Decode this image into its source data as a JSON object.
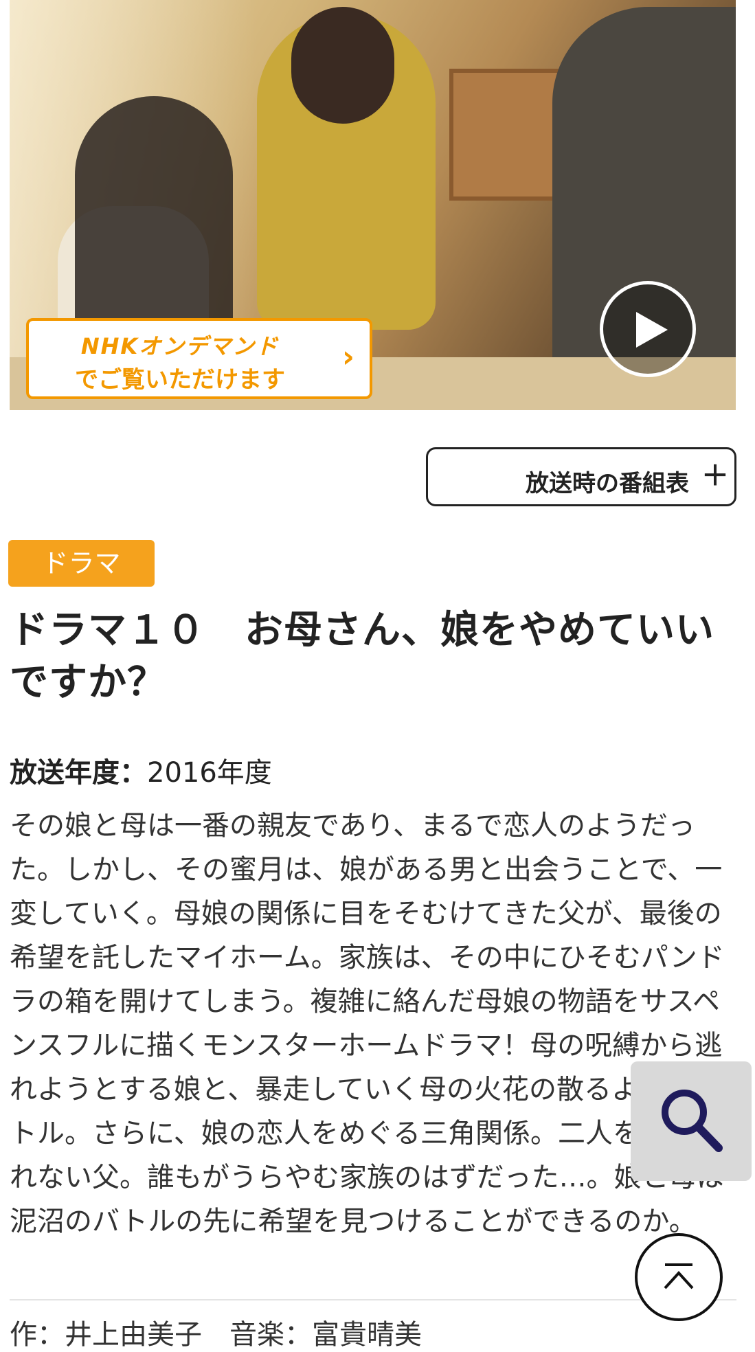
{
  "hero": {
    "ondemand_line1": "NHKオンデマンド",
    "ondemand_line2": "でご覧いただけます",
    "ondemand_arrow": "›",
    "play_icon": "play-icon"
  },
  "schedule_button": {
    "label": "放送時の番組表",
    "icon": "plus-icon",
    "icon_glyph": "＋"
  },
  "genre_badge": "ドラマ",
  "program_title": "ドラマ１０　お母さん、娘をやめていいですか？",
  "broadcast_year": {
    "label": "放送年度：",
    "value": "2016年度"
  },
  "description": "その娘と母は一番の親友であり、まるで恋人のようだった。しかし、その蜜月は、娘がある男と出会うことで、一変していく。母娘の関係に目をそむけてきた父が、最後の希望を託したマイホーム。家族は、その中にひそむパンドラの箱を開けてしまう。複雑に絡んだ母娘の物語をサスペンスフルに描くモンスターホームドラマ！母の呪縛から逃れようとする娘と、暴走していく母の火花の散るようなバトル。さらに、娘の恋人をめぐる三角関係。二人を止められない父。誰もがうらやむ家族のはずだった…。娘と母は泥沼のバトルの先に希望を見つけることができるのか。",
  "credits": "作：井上由美子　音楽：富貴晴美",
  "floating": {
    "search_icon": "search-icon",
    "back_to_top_icon": "back-to-top-icon"
  },
  "colors": {
    "accent_orange": "#f39800",
    "genre_orange": "#f5a21d",
    "search_icon_navy": "#1f1b5c"
  }
}
